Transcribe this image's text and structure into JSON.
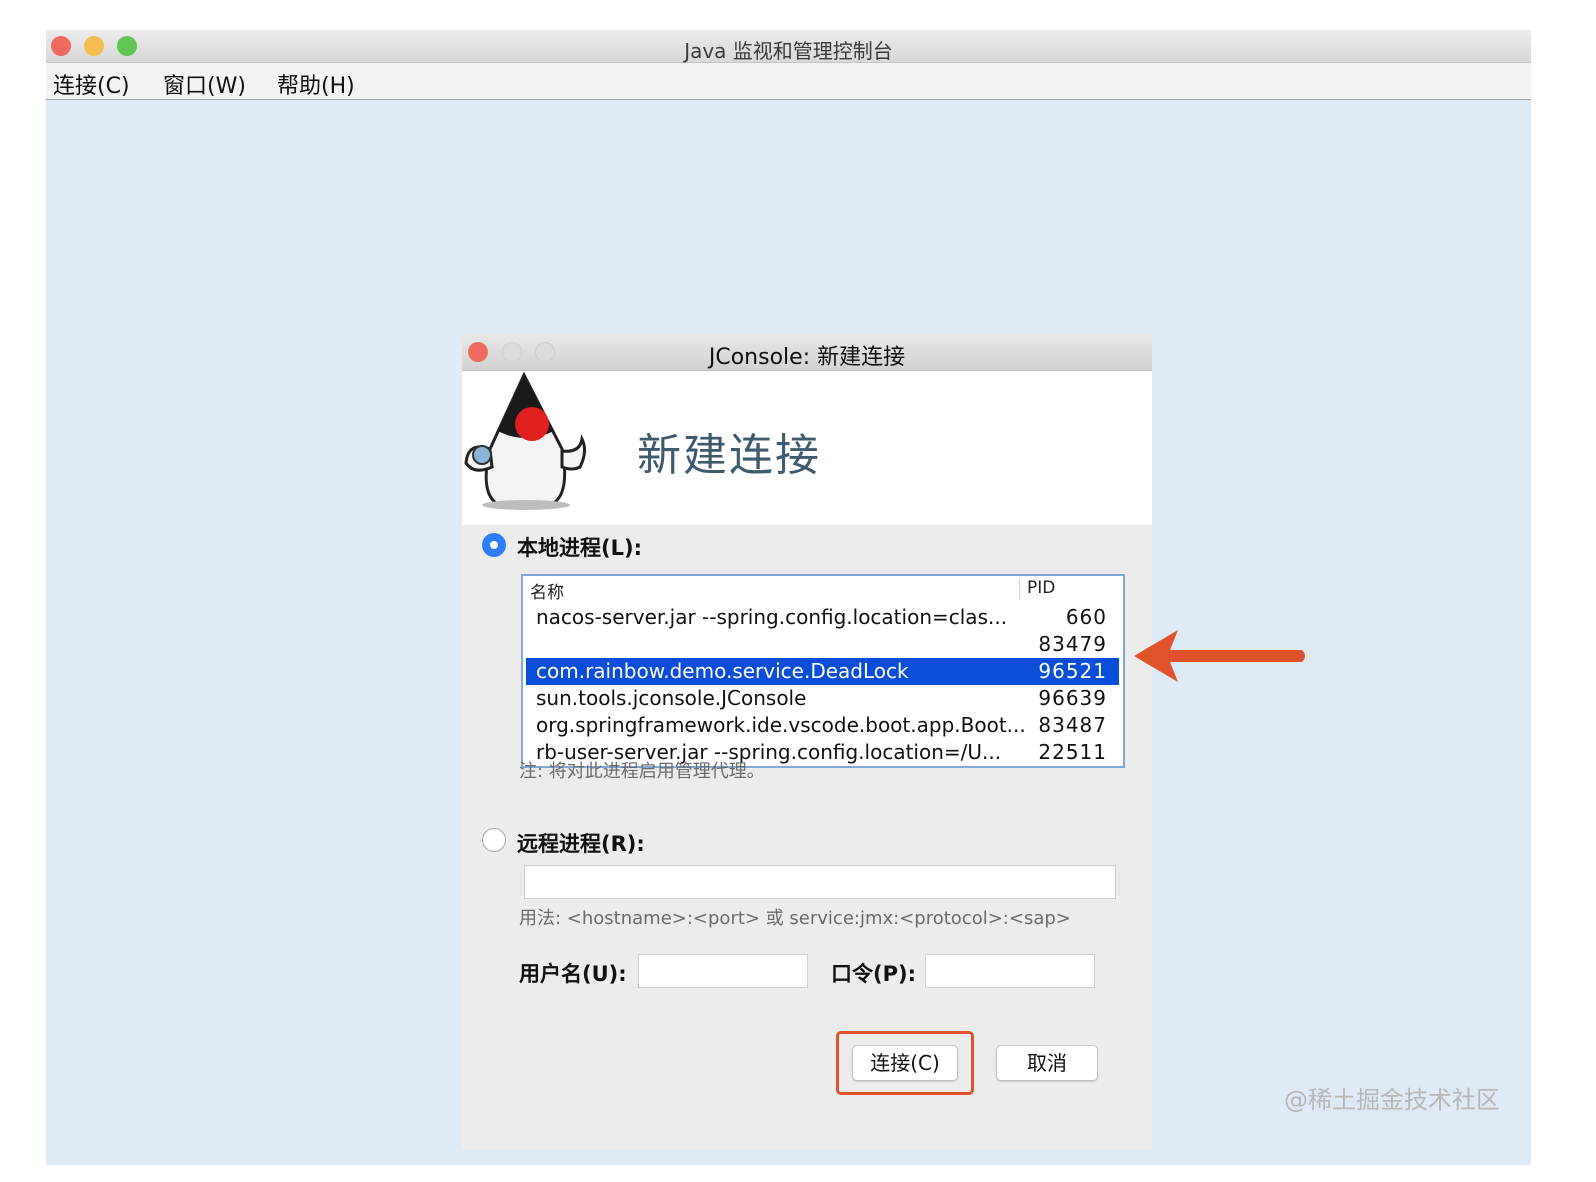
{
  "main_window": {
    "title": "Java 监视和管理控制台",
    "menu": [
      "连接(C)",
      "窗口(W)",
      "帮助(H)"
    ],
    "traffic_light_colors": [
      "#ee6a5f",
      "#f5bd4f",
      "#61c554"
    ]
  },
  "dialog": {
    "title": "JConsole: 新建连接",
    "header_title": "新建连接",
    "local": {
      "label": "本地进程(L):",
      "selected": true,
      "columns": [
        "名称",
        "PID"
      ],
      "rows": [
        {
          "name": "nacos-server.jar --spring.config.location=clas...",
          "pid": "660"
        },
        {
          "name": "",
          "pid": "83479"
        },
        {
          "name": "com.rainbow.demo.service.DeadLock",
          "pid": "96521"
        },
        {
          "name": "sun.tools.jconsole.JConsole",
          "pid": "96639"
        },
        {
          "name": "org.springframework.ide.vscode.boot.app.Boot...",
          "pid": "83487"
        },
        {
          "name": "rb-user-server.jar --spring.config.location=/U...",
          "pid": "22511"
        }
      ],
      "selected_row_index": 2,
      "note": "注: 将对此进程启用管理代理。"
    },
    "remote": {
      "label": "远程进程(R):",
      "selected": false,
      "address_value": "",
      "usage": "用法: <hostname>:<port> 或 service:jmx:<protocol>:<sap>",
      "username_label": "用户名(U):",
      "username_value": "",
      "password_label": "口令(P):",
      "password_value": ""
    },
    "connect_button": "连接(C)",
    "cancel_button": "取消"
  },
  "watermark": "@稀土掘金技术社区",
  "colors": {
    "selection": "#0a4dd9",
    "annotation": "#e0522c",
    "radio_active": "#2f7cf6",
    "desktop": "#dfeaf7"
  }
}
